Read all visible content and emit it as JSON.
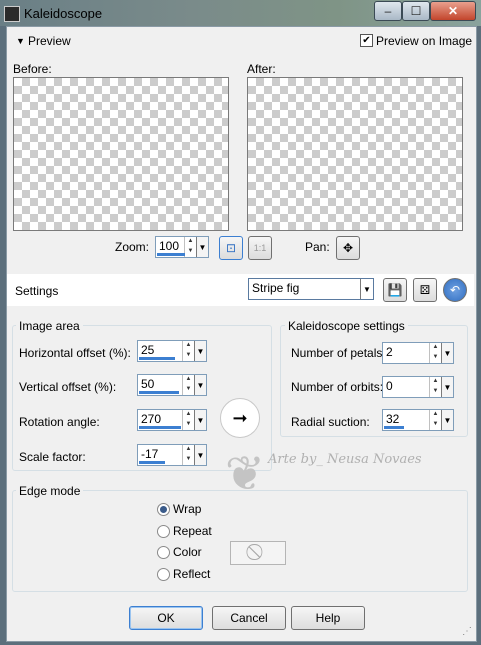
{
  "window": {
    "title": "Kaleidoscope",
    "minimize_glyph": "–",
    "maximize_glyph": "☐",
    "close_glyph": "✕"
  },
  "preview": {
    "toggle_label": "Preview",
    "preview_on_image_label": "Preview on Image",
    "preview_on_image_checked": true,
    "before_label": "Before:",
    "after_label": "After:",
    "zoom_label": "Zoom:",
    "zoom_value": "100",
    "pan_label": "Pan:"
  },
  "settings": {
    "label": "Settings",
    "preset_value": "Stripe fig"
  },
  "image_area": {
    "title": "Image area",
    "fields": [
      {
        "label": "Horizontal offset (%):",
        "value": "25"
      },
      {
        "label": "Vertical offset (%):",
        "value": "50"
      },
      {
        "label": "Rotation angle:",
        "value": "270"
      },
      {
        "label": "Scale factor:",
        "value": "-17"
      }
    ]
  },
  "kaleidoscope_settings": {
    "title": "Kaleidoscope settings",
    "fields": [
      {
        "label": "Number of petals:",
        "value": "2"
      },
      {
        "label": "Number of orbits:",
        "value": "0"
      },
      {
        "label": "Radial suction:",
        "value": "32"
      }
    ]
  },
  "edge_mode": {
    "title": "Edge mode",
    "options": [
      "Wrap",
      "Repeat",
      "Color",
      "Reflect"
    ],
    "selected": "Wrap"
  },
  "watermark_text": "Arte by_ Neusa Novaes",
  "buttons": {
    "ok": "OK",
    "cancel": "Cancel",
    "help": "Help"
  },
  "icons": {
    "zoom_fit": "zoom-fit-icon",
    "actual_size": "actual-size-icon",
    "pan": "pan-move-icon",
    "save_preset": "save-preset-icon",
    "random": "dice-icon",
    "reset": "reset-icon",
    "no_color": "no-color-icon"
  },
  "colors": {
    "accent_bar": "#3c7fd1",
    "titlebar": "#7a8b8a",
    "reset_button": "#2f6ec2"
  }
}
